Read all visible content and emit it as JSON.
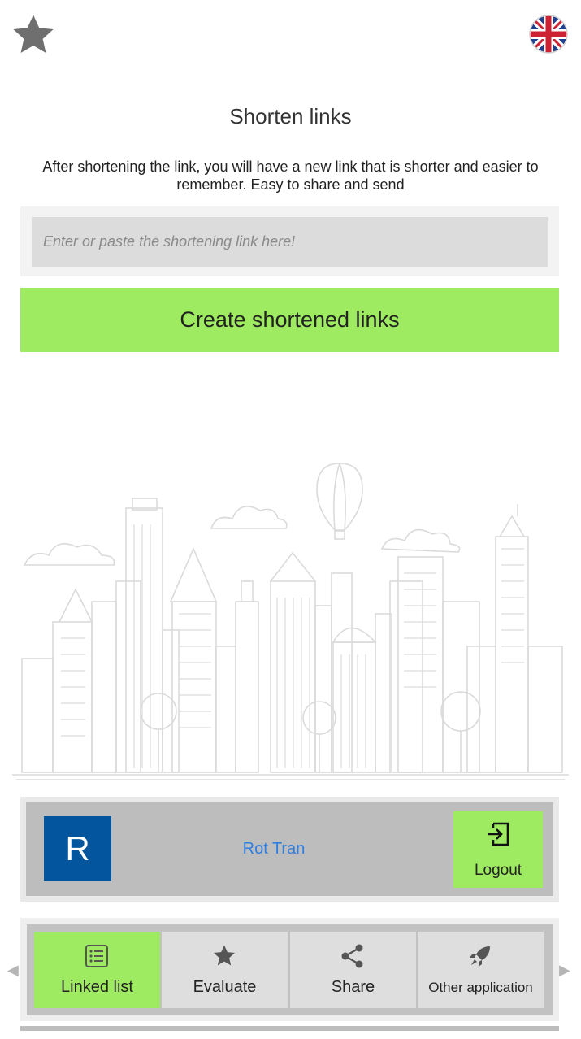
{
  "header": {
    "favorite_icon": "star-icon",
    "language_icon": "uk-flag-icon"
  },
  "main": {
    "title": "Shorten links",
    "description": "After shortening the link, you will have a new link that is shorter and easier to remember. Easy to share and send",
    "input": {
      "placeholder": "Enter or paste the shortening link here!",
      "value": ""
    },
    "create_button": "Create shortened links"
  },
  "user": {
    "avatar_letter": "R",
    "name": "Rot Tran",
    "logout_label": "Logout"
  },
  "tabs": [
    {
      "label": "Linked list",
      "icon": "list-icon",
      "active": true
    },
    {
      "label": "Evaluate",
      "icon": "star-icon",
      "active": false
    },
    {
      "label": "Share",
      "icon": "share-icon",
      "active": false
    },
    {
      "label": "Other application",
      "icon": "rocket-icon",
      "active": false
    }
  ],
  "colors": {
    "accent_green": "#9eea60",
    "avatar_blue": "#03559e",
    "link_blue": "#2f7fe0"
  }
}
